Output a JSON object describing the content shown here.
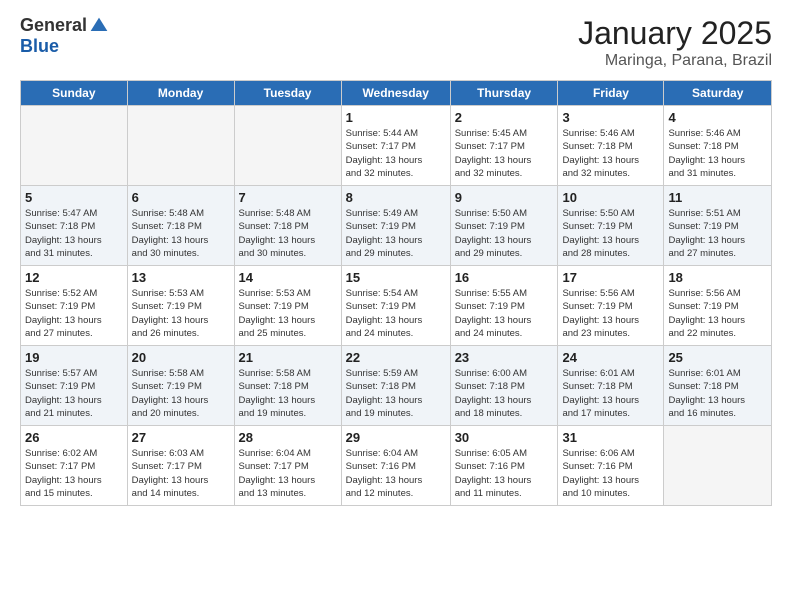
{
  "logo": {
    "general": "General",
    "blue": "Blue"
  },
  "title": "January 2025",
  "location": "Maringa, Parana, Brazil",
  "days_of_week": [
    "Sunday",
    "Monday",
    "Tuesday",
    "Wednesday",
    "Thursday",
    "Friday",
    "Saturday"
  ],
  "weeks": [
    [
      {
        "day": "",
        "info": ""
      },
      {
        "day": "",
        "info": ""
      },
      {
        "day": "",
        "info": ""
      },
      {
        "day": "1",
        "info": "Sunrise: 5:44 AM\nSunset: 7:17 PM\nDaylight: 13 hours\nand 32 minutes."
      },
      {
        "day": "2",
        "info": "Sunrise: 5:45 AM\nSunset: 7:17 PM\nDaylight: 13 hours\nand 32 minutes."
      },
      {
        "day": "3",
        "info": "Sunrise: 5:46 AM\nSunset: 7:18 PM\nDaylight: 13 hours\nand 32 minutes."
      },
      {
        "day": "4",
        "info": "Sunrise: 5:46 AM\nSunset: 7:18 PM\nDaylight: 13 hours\nand 31 minutes."
      }
    ],
    [
      {
        "day": "5",
        "info": "Sunrise: 5:47 AM\nSunset: 7:18 PM\nDaylight: 13 hours\nand 31 minutes."
      },
      {
        "day": "6",
        "info": "Sunrise: 5:48 AM\nSunset: 7:18 PM\nDaylight: 13 hours\nand 30 minutes."
      },
      {
        "day": "7",
        "info": "Sunrise: 5:48 AM\nSunset: 7:18 PM\nDaylight: 13 hours\nand 30 minutes."
      },
      {
        "day": "8",
        "info": "Sunrise: 5:49 AM\nSunset: 7:19 PM\nDaylight: 13 hours\nand 29 minutes."
      },
      {
        "day": "9",
        "info": "Sunrise: 5:50 AM\nSunset: 7:19 PM\nDaylight: 13 hours\nand 29 minutes."
      },
      {
        "day": "10",
        "info": "Sunrise: 5:50 AM\nSunset: 7:19 PM\nDaylight: 13 hours\nand 28 minutes."
      },
      {
        "day": "11",
        "info": "Sunrise: 5:51 AM\nSunset: 7:19 PM\nDaylight: 13 hours\nand 27 minutes."
      }
    ],
    [
      {
        "day": "12",
        "info": "Sunrise: 5:52 AM\nSunset: 7:19 PM\nDaylight: 13 hours\nand 27 minutes."
      },
      {
        "day": "13",
        "info": "Sunrise: 5:53 AM\nSunset: 7:19 PM\nDaylight: 13 hours\nand 26 minutes."
      },
      {
        "day": "14",
        "info": "Sunrise: 5:53 AM\nSunset: 7:19 PM\nDaylight: 13 hours\nand 25 minutes."
      },
      {
        "day": "15",
        "info": "Sunrise: 5:54 AM\nSunset: 7:19 PM\nDaylight: 13 hours\nand 24 minutes."
      },
      {
        "day": "16",
        "info": "Sunrise: 5:55 AM\nSunset: 7:19 PM\nDaylight: 13 hours\nand 24 minutes."
      },
      {
        "day": "17",
        "info": "Sunrise: 5:56 AM\nSunset: 7:19 PM\nDaylight: 13 hours\nand 23 minutes."
      },
      {
        "day": "18",
        "info": "Sunrise: 5:56 AM\nSunset: 7:19 PM\nDaylight: 13 hours\nand 22 minutes."
      }
    ],
    [
      {
        "day": "19",
        "info": "Sunrise: 5:57 AM\nSunset: 7:19 PM\nDaylight: 13 hours\nand 21 minutes."
      },
      {
        "day": "20",
        "info": "Sunrise: 5:58 AM\nSunset: 7:19 PM\nDaylight: 13 hours\nand 20 minutes."
      },
      {
        "day": "21",
        "info": "Sunrise: 5:58 AM\nSunset: 7:18 PM\nDaylight: 13 hours\nand 19 minutes."
      },
      {
        "day": "22",
        "info": "Sunrise: 5:59 AM\nSunset: 7:18 PM\nDaylight: 13 hours\nand 19 minutes."
      },
      {
        "day": "23",
        "info": "Sunrise: 6:00 AM\nSunset: 7:18 PM\nDaylight: 13 hours\nand 18 minutes."
      },
      {
        "day": "24",
        "info": "Sunrise: 6:01 AM\nSunset: 7:18 PM\nDaylight: 13 hours\nand 17 minutes."
      },
      {
        "day": "25",
        "info": "Sunrise: 6:01 AM\nSunset: 7:18 PM\nDaylight: 13 hours\nand 16 minutes."
      }
    ],
    [
      {
        "day": "26",
        "info": "Sunrise: 6:02 AM\nSunset: 7:17 PM\nDaylight: 13 hours\nand 15 minutes."
      },
      {
        "day": "27",
        "info": "Sunrise: 6:03 AM\nSunset: 7:17 PM\nDaylight: 13 hours\nand 14 minutes."
      },
      {
        "day": "28",
        "info": "Sunrise: 6:04 AM\nSunset: 7:17 PM\nDaylight: 13 hours\nand 13 minutes."
      },
      {
        "day": "29",
        "info": "Sunrise: 6:04 AM\nSunset: 7:16 PM\nDaylight: 13 hours\nand 12 minutes."
      },
      {
        "day": "30",
        "info": "Sunrise: 6:05 AM\nSunset: 7:16 PM\nDaylight: 13 hours\nand 11 minutes."
      },
      {
        "day": "31",
        "info": "Sunrise: 6:06 AM\nSunset: 7:16 PM\nDaylight: 13 hours\nand 10 minutes."
      },
      {
        "day": "",
        "info": ""
      }
    ]
  ]
}
